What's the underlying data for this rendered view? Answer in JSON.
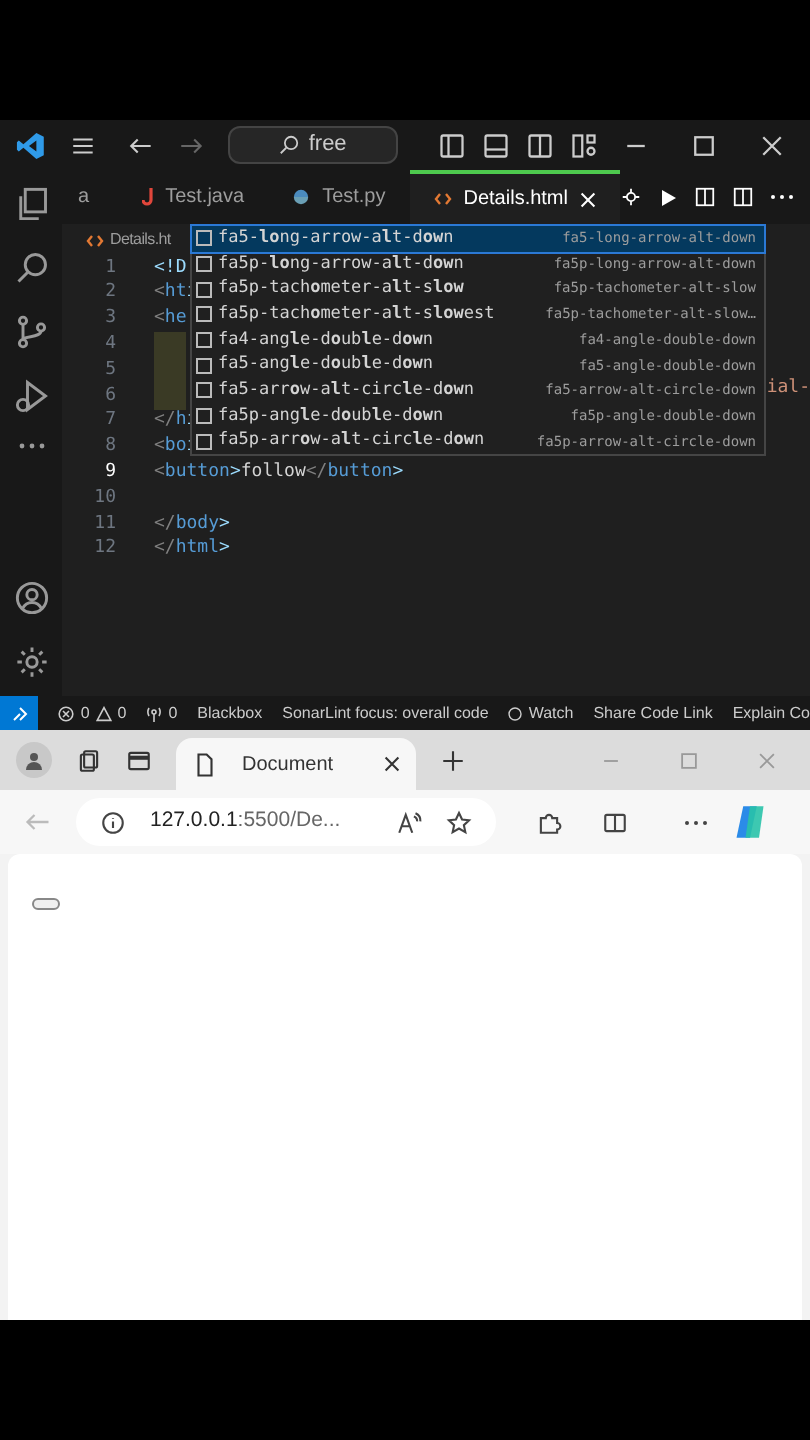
{
  "editor_window": {
    "search": "free",
    "tabs": [
      {
        "label": "a",
        "selected": false,
        "kind": "plain"
      },
      {
        "label": "Test.java",
        "selected": false,
        "kind": "java"
      },
      {
        "label": "Test.py",
        "selected": false,
        "kind": "python"
      },
      {
        "label": "Details.html",
        "selected": true,
        "kind": "html"
      }
    ],
    "breadcrumb": "Details.ht",
    "code_lines": [
      {
        "number": "1",
        "text": "<!D",
        "current": false
      },
      {
        "number": "2",
        "text": "<htı",
        "current": false
      },
      {
        "number": "3",
        "text": "<he",
        "current": false
      },
      {
        "number": "4",
        "current": false,
        "kind": "highlight"
      },
      {
        "number": "5",
        "current": false,
        "kind": "highlight"
      },
      {
        "number": "6",
        "current": false,
        "kind": "highlight"
      },
      {
        "number": "7",
        "text": "</hı",
        "current": false
      },
      {
        "number": "8",
        "text": "<boı",
        "current": false
      },
      {
        "number": "9",
        "text": "<button>follow</button>",
        "current": true
      },
      {
        "number": "10",
        "current": false
      },
      {
        "number": "11",
        "text": "</body>",
        "current": false
      },
      {
        "number": "12",
        "text": "</html>",
        "current": false
      }
    ],
    "overflow_text": "ial-",
    "suggestions": [
      {
        "label": "fa5-**lo**ng-arrow-a**l**t-d**ow**n",
        "detail": "fa5-long-arrow-alt-down",
        "selected": true
      },
      {
        "label": "fa5p-**lo**ng-arrow-a**l**t-d**ow**n",
        "detail": "fa5p-long-arrow-alt-down",
        "selected": false
      },
      {
        "label": "fa5p-tach**o**meter-a**l**t-s**low**",
        "detail": "fa5p-tachometer-alt-slow",
        "selected": false
      },
      {
        "label": "fa5p-tach**o**meter-a**l**t-s**low**est",
        "detail": "fa5p-tachometer-alt-slow…",
        "selected": false
      },
      {
        "label": "fa4-ang**l**e-d**o**ub**l**e-d**ow**n",
        "detail": "fa4-angle-double-down",
        "selected": false
      },
      {
        "label": "fa5-ang**l**e-d**o**ub**l**e-d**ow**n",
        "detail": "fa5-angle-double-down",
        "selected": false
      },
      {
        "label": "fa5-arr**o**w-a**l**t-circ**l**e-d**ow**n",
        "detail": "fa5-arrow-alt-circle-down",
        "selected": false
      },
      {
        "label": "fa5p-ang**l**e-d**o**ub**l**e-d**ow**n",
        "detail": "fa5p-angle-double-down",
        "selected": false
      },
      {
        "label": "fa5p-arr**o**w-a**l**t-circ**l**e-d**ow**n",
        "detail": "fa5p-arrow-alt-circle-down",
        "selected": false
      }
    ],
    "status_bar": {
      "errors": "0",
      "warnings": "0",
      "ports": "0",
      "items": [
        "Blackbox",
        "SonarLint focus: overall code",
        "Watch",
        "Share Code Link",
        "Explain Co"
      ]
    }
  },
  "browser_window": {
    "tab_title": "Document",
    "address": "127.0.0.1",
    "address_rest": ":5500/De..."
  }
}
